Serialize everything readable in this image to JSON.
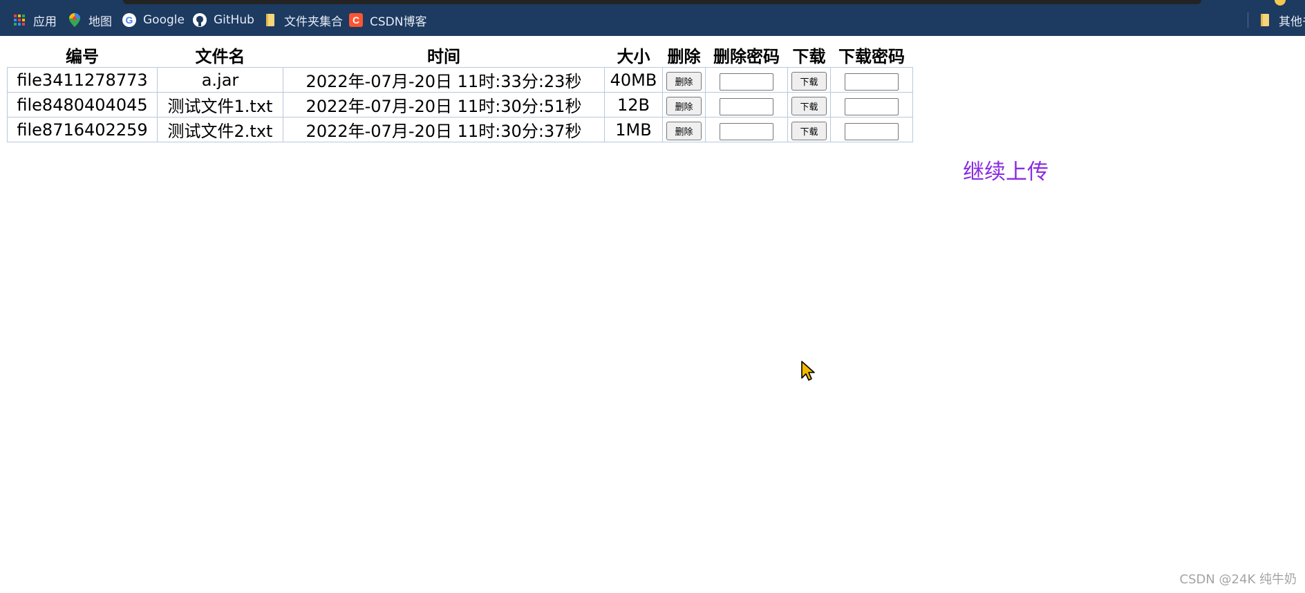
{
  "bookmarks": {
    "items": [
      {
        "label": "应用",
        "icon": "apps-grid-icon"
      },
      {
        "label": "地图",
        "icon": "map-pin-icon"
      },
      {
        "label": "Google",
        "icon": "google-icon"
      },
      {
        "label": "GitHub",
        "icon": "github-icon"
      },
      {
        "label": "文件夹集合",
        "icon": "folder-icon"
      },
      {
        "label": "CSDN博客",
        "icon": "csdn-icon"
      }
    ],
    "other_label": "其他书"
  },
  "table": {
    "headers": [
      "编号",
      "文件名",
      "时间",
      "大小",
      "删除",
      "删除密码",
      "下载",
      "下载密码"
    ],
    "delete_button_label": "删除",
    "download_button_label": "下载",
    "rows": [
      {
        "id": "file3411278773",
        "name": "a.jar",
        "time": "2022年-07月-20日 11时:33分:23秒",
        "size": "40MB"
      },
      {
        "id": "file8480404045",
        "name": "测试文件1.txt",
        "time": "2022年-07月-20日 11时:30分:51秒",
        "size": "12B"
      },
      {
        "id": "file8716402259",
        "name": "测试文件2.txt",
        "time": "2022年-07月-20日 11时:30分:37秒",
        "size": "1MB"
      }
    ]
  },
  "continue_upload_label": "继续上传",
  "watermark": "CSDN @24K   纯牛奶",
  "colors": {
    "bookmark_bar_bg": "#1d3a61",
    "link": "#8a2be2",
    "table_border": "#b8c8dc"
  }
}
